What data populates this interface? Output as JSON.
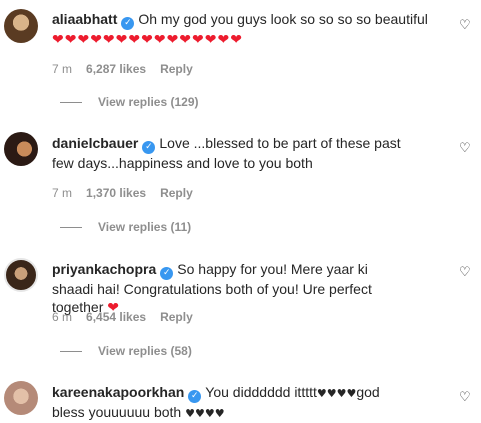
{
  "comments": [
    {
      "username": "aliaabhatt",
      "verified_icon": "verified-badge-icon",
      "text": "Oh my god you guys look so so so so beautiful",
      "hearts": "❤❤❤❤❤❤❤❤❤❤❤❤❤❤❤",
      "time": "7 m",
      "likes": "6,287 likes",
      "reply": "Reply",
      "view_replies": "View replies (129)"
    },
    {
      "username": "danielcbauer",
      "verified_icon": "verified-badge-icon",
      "text": "Love ...blessed to be part of these past few days...happiness and love to you both",
      "time": "7 m",
      "likes": "1,370 likes",
      "reply": "Reply",
      "view_replies": "View replies (11)"
    },
    {
      "username": "priyankachopra",
      "verified_icon": "verified-badge-icon",
      "text": "So happy for you! Mere yaar ki shaadi hai! Congratulations both of you! Ure perfect together",
      "hearts": "❤",
      "time": "6 m",
      "likes": "6,454 likes",
      "reply": "Reply",
      "view_replies": "View replies (58)"
    },
    {
      "username": "kareenakapoorkhan",
      "verified_icon": "verified-badge-icon",
      "text_before": "You didddddd ittttt",
      "hearts_mid": "♥♥♥♥",
      "text_after": "god bless youuuuuu both",
      "hearts_end": "♥♥♥♥"
    }
  ],
  "colors": {
    "verified": "#3897f0",
    "heart_red": "#ed1c2e",
    "muted": "#8e8e8e"
  }
}
